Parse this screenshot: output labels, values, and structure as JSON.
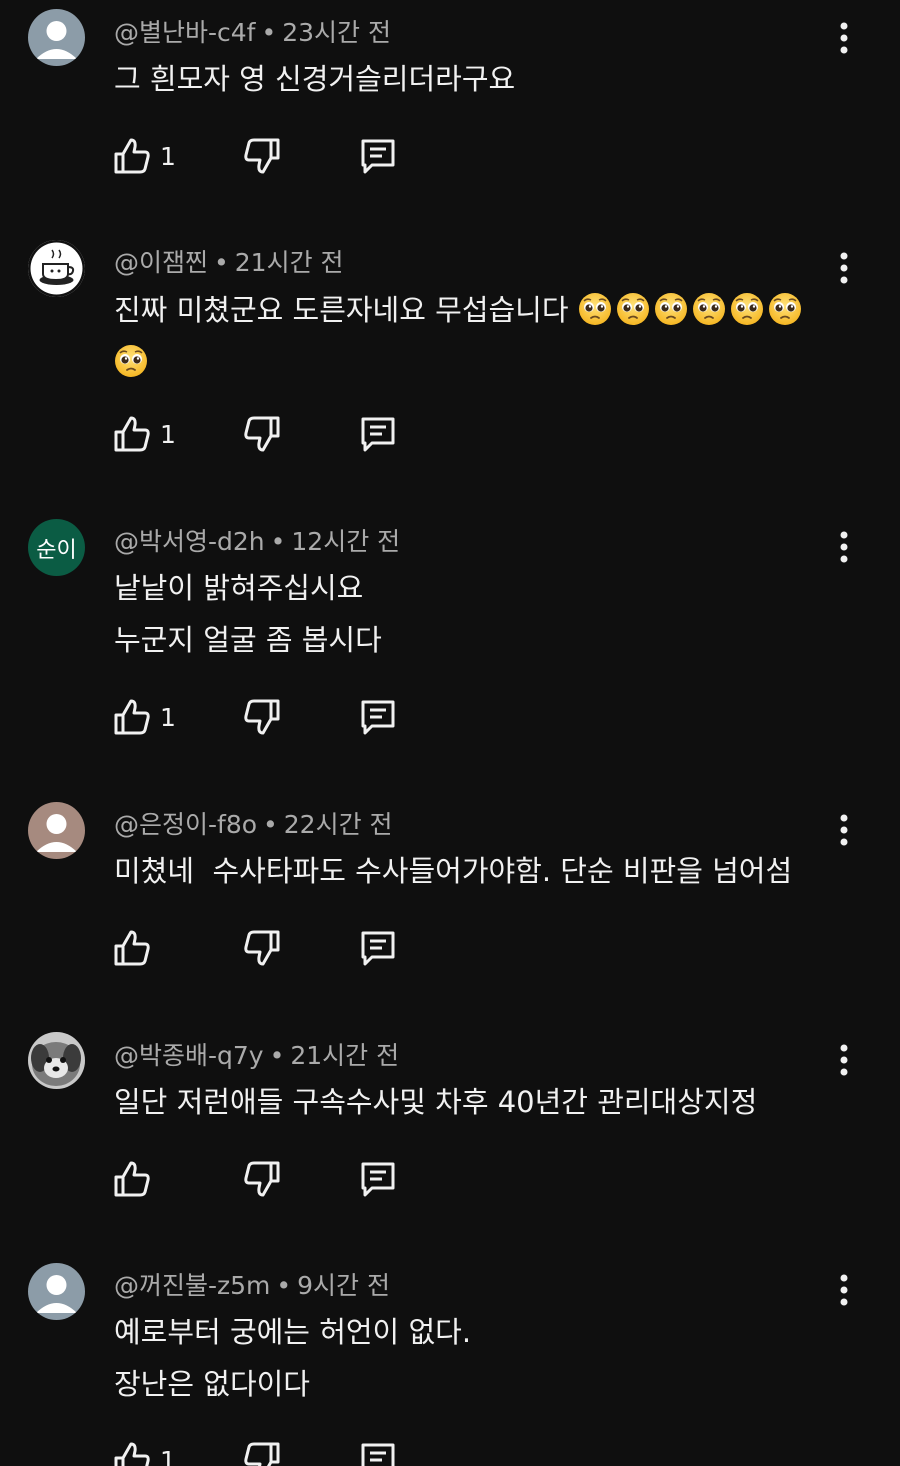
{
  "comments": [
    {
      "author": "@별난바-c4f",
      "time": "23시간 전",
      "lines": [
        "그 흰모자 영 신경거슬리더라구요"
      ],
      "likes": "1",
      "avatar": "default-avatar"
    },
    {
      "author": "@이잼찐",
      "time": "21시간 전",
      "lines": [
        "진짜 미쳤군요 도른자네요 무섭습니다"
      ],
      "emoji_count_line1": 6,
      "emoji_count_line2": 1,
      "emoji": "pleading-face",
      "likes": "1",
      "avatar": "coffee-cup-photo"
    },
    {
      "author": "@박서영-d2h",
      "time": "12시간 전",
      "lines": [
        "낱낱이 밝혀주십시요",
        "누군지 얼굴 좀 봅시다"
      ],
      "likes": "1",
      "avatar": "text-avatar",
      "avatar_text": "순이",
      "avatar_color": "#0b5c44"
    },
    {
      "author": "@은정이-f8o",
      "time": "22시간 전",
      "lines": [
        "미쳤네  수사타파도 수사들어가야함. 단순 비판을 넘어섬"
      ],
      "likes": "",
      "avatar": "default-avatar-brown"
    },
    {
      "author": "@박종배-q7y",
      "time": "21시간 전",
      "lines": [
        "일단 저런애들 구속수사및 차후 40년간 관리대상지정"
      ],
      "likes": "",
      "avatar": "dog-photo"
    },
    {
      "author": "@꺼진불-z5m",
      "time": "9시간 전",
      "lines": [
        "예로부터 궁에는 허언이 없다.",
        "장난은 없다이다"
      ],
      "likes": "1",
      "avatar": "default-avatar"
    }
  ],
  "ui": {
    "dot": "•",
    "icons": {
      "like": "thumb-up-icon",
      "dislike": "thumb-down-icon",
      "reply": "reply-icon",
      "more": "more-vert-icon"
    },
    "colors": {
      "background": "#0f0f0f",
      "text": "#f1f1f1",
      "meta": "#aaaaaa",
      "default_avatar": "#8c9ca8",
      "brown_avatar": "#a68a7f"
    }
  }
}
